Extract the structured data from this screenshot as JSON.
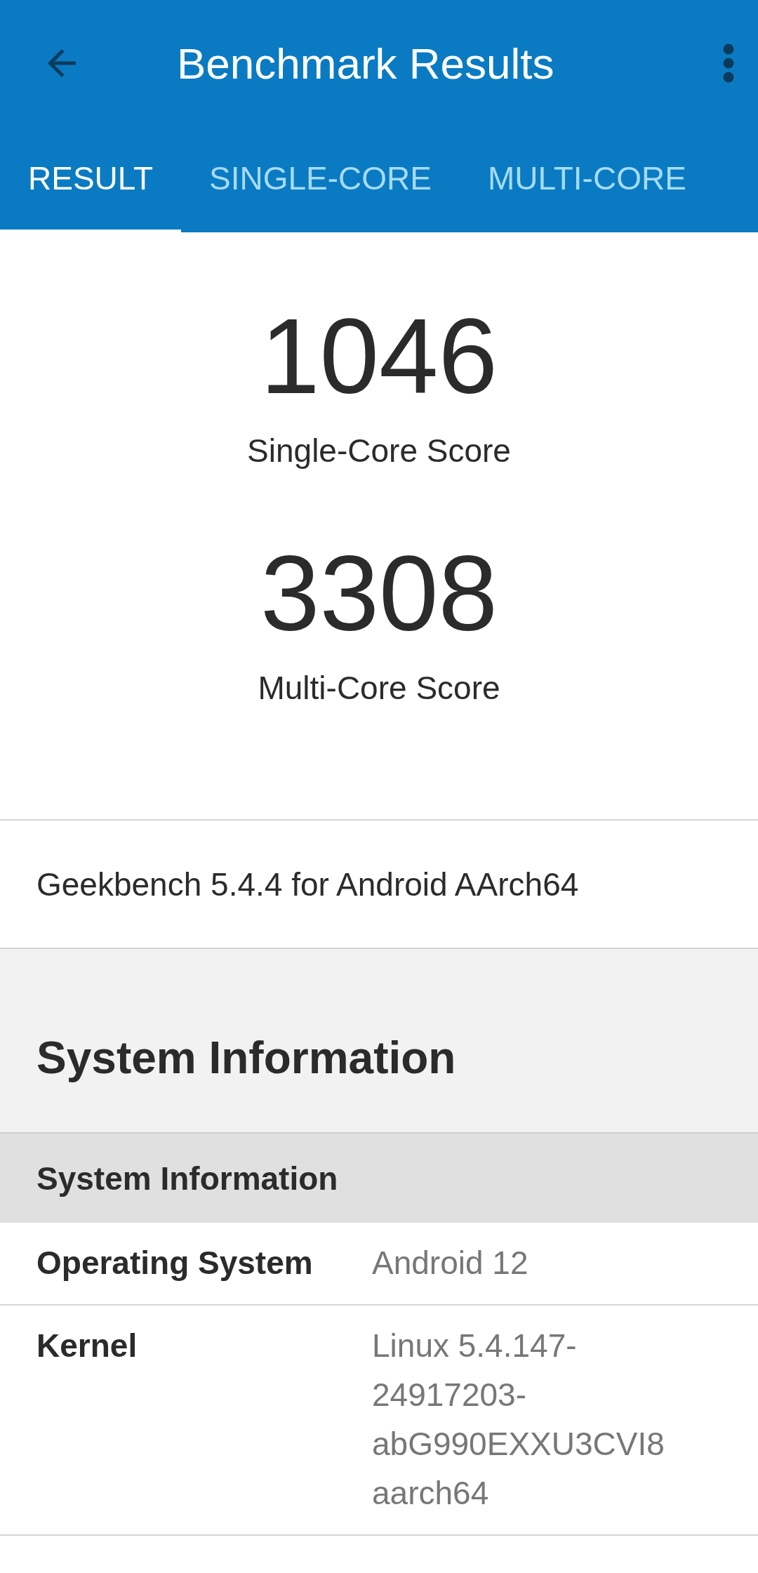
{
  "app_bar": {
    "title": "Benchmark Results"
  },
  "tabs": [
    {
      "label": "RESULT",
      "selected": true
    },
    {
      "label": "SINGLE-CORE",
      "selected": false
    },
    {
      "label": "MULTI-CORE",
      "selected": false
    }
  ],
  "scores": [
    {
      "value": "1046",
      "label": "Single-Core Score"
    },
    {
      "value": "3308",
      "label": "Multi-Core Score"
    }
  ],
  "version": "Geekbench 5.4.4 for Android AArch64",
  "section": {
    "title": "System Information",
    "subheader": "System Information",
    "rows": [
      {
        "name": "Operating System",
        "value": "Android 12"
      },
      {
        "name": "Kernel",
        "value": "Linux 5.4.147-24917203-abG990EXXU3CVI8 aarch64"
      }
    ]
  }
}
